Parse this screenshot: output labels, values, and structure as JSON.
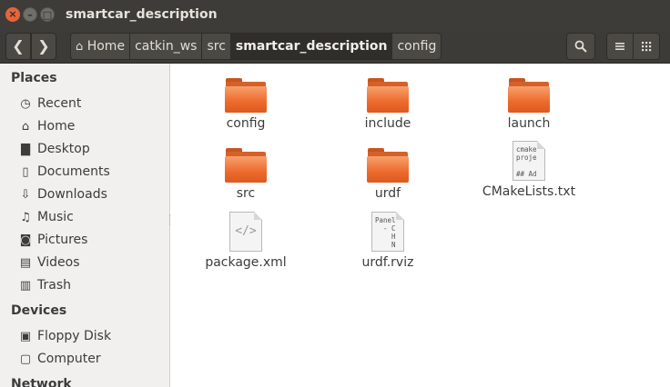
{
  "window": {
    "title": "smartcar_description"
  },
  "toolbar": {
    "back_icon": "chevron-left-icon",
    "forward_icon": "chevron-right-icon",
    "breadcrumbs": [
      {
        "label": "Home",
        "icon": "home-icon"
      },
      {
        "label": "catkin_ws"
      },
      {
        "label": "src"
      },
      {
        "label": "smartcar_description",
        "active": true
      },
      {
        "label": "config"
      }
    ],
    "search_icon": "search-icon",
    "list_view_icon": "list-view-icon",
    "grid_view_icon": "grid-view-icon"
  },
  "sidebar": {
    "sections": [
      {
        "title": "Places",
        "items": [
          {
            "label": "Recent",
            "icon": "clock-icon"
          },
          {
            "label": "Home",
            "icon": "home-icon"
          },
          {
            "label": "Desktop",
            "icon": "folder-icon"
          },
          {
            "label": "Documents",
            "icon": "document-icon"
          },
          {
            "label": "Downloads",
            "icon": "download-icon"
          },
          {
            "label": "Music",
            "icon": "music-icon"
          },
          {
            "label": "Pictures",
            "icon": "camera-icon"
          },
          {
            "label": "Videos",
            "icon": "film-icon"
          },
          {
            "label": "Trash",
            "icon": "trash-icon"
          }
        ]
      },
      {
        "title": "Devices",
        "items": [
          {
            "label": "Floppy Disk",
            "icon": "floppy-icon"
          },
          {
            "label": "Computer",
            "icon": "computer-icon"
          }
        ]
      },
      {
        "title": "Network",
        "items": []
      }
    ]
  },
  "files": [
    {
      "name": "config",
      "type": "folder"
    },
    {
      "name": "include",
      "type": "folder"
    },
    {
      "name": "launch",
      "type": "folder"
    },
    {
      "name": "src",
      "type": "folder"
    },
    {
      "name": "urdf",
      "type": "folder"
    },
    {
      "name": "CMakeLists.txt",
      "type": "text",
      "preview": "cmake\nproje\n\n## Ad"
    },
    {
      "name": "package.xml",
      "type": "xml",
      "preview": "</>"
    },
    {
      "name": "urdf.rviz",
      "type": "text",
      "preview": "Panel\n  - C\n    H\n    N"
    }
  ],
  "colors": {
    "folder_orange": "#ec6a2c",
    "titlebar": "#3d3c38",
    "close_button": "#e5643b"
  }
}
